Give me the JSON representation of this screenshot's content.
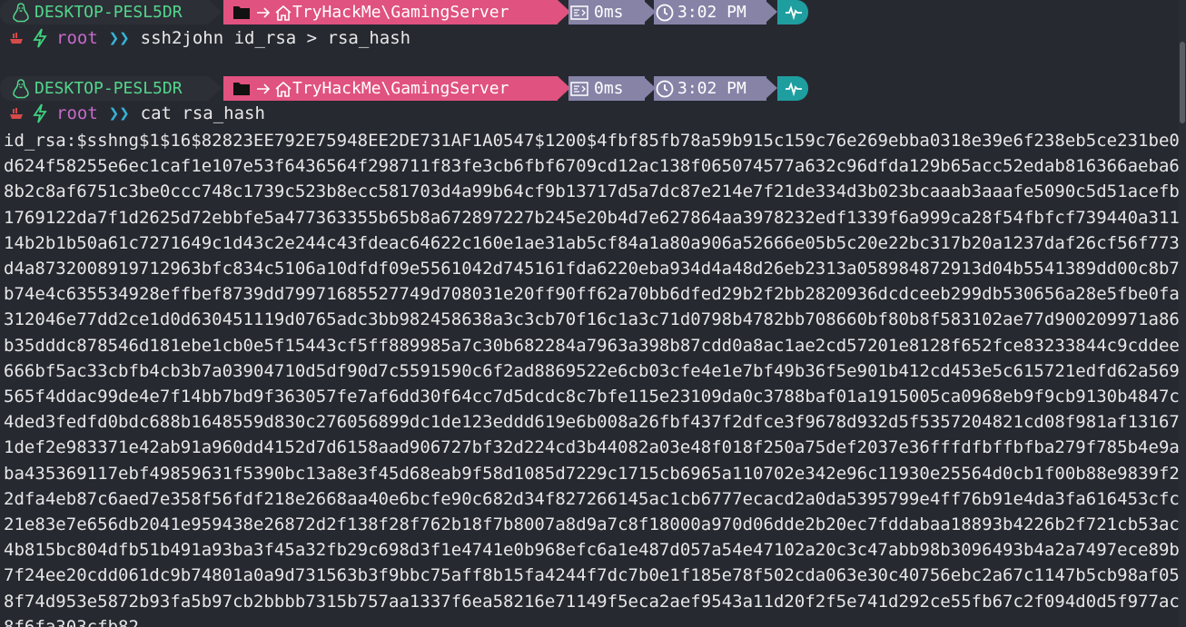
{
  "prompts": [
    {
      "host": "DESKTOP-PESL5DR",
      "path": "TryHackMe\\GamingServer",
      "duration": "0ms",
      "clock": "3:02 PM",
      "user": "root",
      "chevrons": "❯❯",
      "command": "ssh2john id_rsa > rsa_hash"
    },
    {
      "host": "DESKTOP-PESL5DR",
      "path": "TryHackMe\\GamingServer",
      "duration": "0ms",
      "clock": "3:02 PM",
      "user": "root",
      "chevrons": "❯❯",
      "command": "cat rsa_hash"
    }
  ],
  "output_text": "id_rsa:$sshng$1$16$82823EE792E75948EE2DE731AF1A0547$1200$4fbf85fb78a59b915c159c76e269ebba0318e39e6f238eb5ce231be0d624f58255e6ec1caf1e107e53f6436564f298711f83fe3cb6fbf6709cd12ac138f065074577a632c96dfda129b65acc52edab816366aeba68b2c8af6751c3be0ccc748c1739c523b8ecc581703d4a99b64cf9b13717d5a7dc87e214e7f21de334d3b023bcaaab3aaafe5090c5d51acefb1769122da7f1d2625d72ebbfe5a477363355b65b8a672897227b245e20b4d7e627864aa3978232edf1339f6a999ca28f54fbfcf739440a31114b2b1b50a61c7271649c1d43c2e244c43fdeac64622c160e1ae31ab5cf84a1a80a906a52666e05b5c20e22bc317b20a1237daf26cf56f773d4a8732008919712963bfc834c5106a10dfdf09e5561042d745161fda6220eba934d4a48d26eb2313a058984872913d04b5541389dd00c8b7b74e4c635534928effbef8739dd79971685527749d708031e20ff90ff62a70bb6dfed29b2f2bb2820936dcdceeb299db530656a28e5fbe0fa312046e77dd2ce1d0d630451119d0765adc3bb982458638a3c3cb70f16c1a3c71d0798b4782bb708660bf80b8f583102ae77d900209971a86b35dddc878546d181ebe1cb0e5f15443cf5ff889985a7c30b682284a7963a398b87cdd0a8ac1ae2cd57201e8128f652fce83233844c9cddee666bf5ac33cbfb4cb3b7a03904710d5df90d7c5591590c6f2ad8869522e6cb03cfe4e1e7bf49b36f5e901b412cd453e5c615721edfd62a569565f4ddac99de4e7f14bb7bd9f363057fe7af6dd30f64cc7d5dcdc8c7bfe115e23109da0c3788baf01a1915005ca0968eb9f9cb9130b4847c4ded3fedfd0bdc688b1648559d830c276056899dc1de123eddd619e6b008a26fbf437f2dfce3f9678d932d5f5357204821cd08f981af131671def2e983371e42ab91a960dd4152d7d6158aad906727bf32d224cd3b44082a03e48f018f250a75def2037e36fffdfbffbfba279f785b4e9aba435369117ebf49859631f5390bc13a8e3f45d68eab9f58d1085d7229c1715cb6965a110702e342e96c11930e25564d0cb1f00b88e9839f22dfa4eb87c6aed7e358f56fdf218e2668aa40e6bcfe90c682d34f827266145ac1cb6777ecacd2a0da5395799e4ff76b91e4da3fa616453cfc21e83e7e656db2041e959438e26872d2f138f28f762b18f7b8007a8d9a7c8f18000a970d06dde2b20ec7fddabaa18893b4226b2f721cb53ac4b815bc804dfb51b491a93ba3f45a32fb29c698d3f1e4741e0b968efc6a1e487d057a54e47102a20c3c47abb98b3096493b4a2a7497ece89b7f24ee20cdd061dc9b74801a0a9d731563b3f9bbc75aff8b15fa4244f7dc7b0e1f185e78f502cda063e30c40756ebc2a67c1147b5cb98af058f74d953e5872b93fa5b97cb2bbbb7315b757aa1337f6ea58216e71149f5eca2aef9543a11d20f2f5e741d292ce55fb67c2f094d0d5f977ac8f6fa303cfb82",
  "colors": {
    "background": "#272931",
    "host_segment": "#2d2f37",
    "host_text": "#52d68a",
    "path_segment": "#e0527f",
    "time_segment": "#8683a7",
    "status_segment": "#1f9ea0",
    "user_text": "#c56ac9",
    "chevron_text": "#36b3d6",
    "bolt": "#3fd27f",
    "ship": "#d64a4a"
  },
  "icons": [
    "linux-icon",
    "folder-icon",
    "arrow-right-icon",
    "home-icon",
    "timer-icon",
    "clock-icon",
    "pulse-icon",
    "ship-icon",
    "bolt-icon"
  ]
}
